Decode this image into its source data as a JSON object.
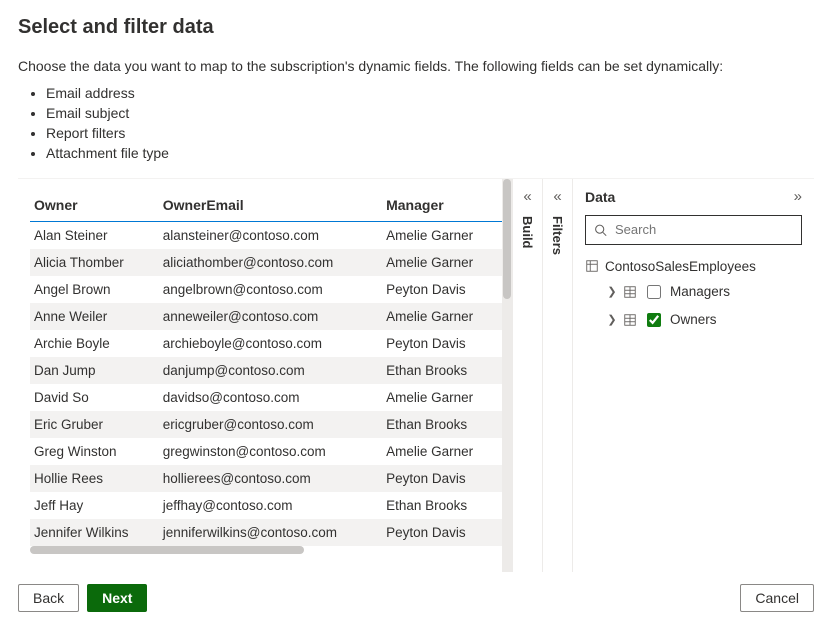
{
  "title": "Select and filter data",
  "intro": "Choose the data you want to map to the subscription's dynamic fields. The following fields can be set dynamically:",
  "bullet_fields": [
    "Email address",
    "Email subject",
    "Report filters",
    "Attachment file type"
  ],
  "columns": [
    "Owner",
    "OwnerEmail",
    "Manager"
  ],
  "rows": [
    {
      "owner": "Alan Steiner",
      "email": "alansteiner@contoso.com",
      "manager": "Amelie Garner"
    },
    {
      "owner": "Alicia Thomber",
      "email": "aliciathomber@contoso.com",
      "manager": "Amelie Garner"
    },
    {
      "owner": "Angel Brown",
      "email": "angelbrown@contoso.com",
      "manager": "Peyton Davis"
    },
    {
      "owner": "Anne Weiler",
      "email": "anneweiler@contoso.com",
      "manager": "Amelie Garner"
    },
    {
      "owner": "Archie Boyle",
      "email": "archieboyle@contoso.com",
      "manager": "Peyton Davis"
    },
    {
      "owner": "Dan Jump",
      "email": "danjump@contoso.com",
      "manager": "Ethan Brooks"
    },
    {
      "owner": "David So",
      "email": "davidso@contoso.com",
      "manager": "Amelie Garner"
    },
    {
      "owner": "Eric Gruber",
      "email": "ericgruber@contoso.com",
      "manager": "Ethan Brooks"
    },
    {
      "owner": "Greg Winston",
      "email": "gregwinston@contoso.com",
      "manager": "Amelie Garner"
    },
    {
      "owner": "Hollie Rees",
      "email": "hollierees@contoso.com",
      "manager": "Peyton Davis"
    },
    {
      "owner": "Jeff Hay",
      "email": "jeffhay@contoso.com",
      "manager": "Ethan Brooks"
    },
    {
      "owner": "Jennifer Wilkins",
      "email": "jenniferwilkins@contoso.com",
      "manager": "Peyton Davis"
    }
  ],
  "rails": {
    "build": "Build",
    "filters": "Filters"
  },
  "data_pane": {
    "title": "Data",
    "search_placeholder": "Search",
    "dataset": "ContosoSalesEmployees",
    "tables": [
      {
        "name": "Managers",
        "checked": false
      },
      {
        "name": "Owners",
        "checked": true
      }
    ]
  },
  "buttons": {
    "back": "Back",
    "next": "Next",
    "cancel": "Cancel"
  }
}
